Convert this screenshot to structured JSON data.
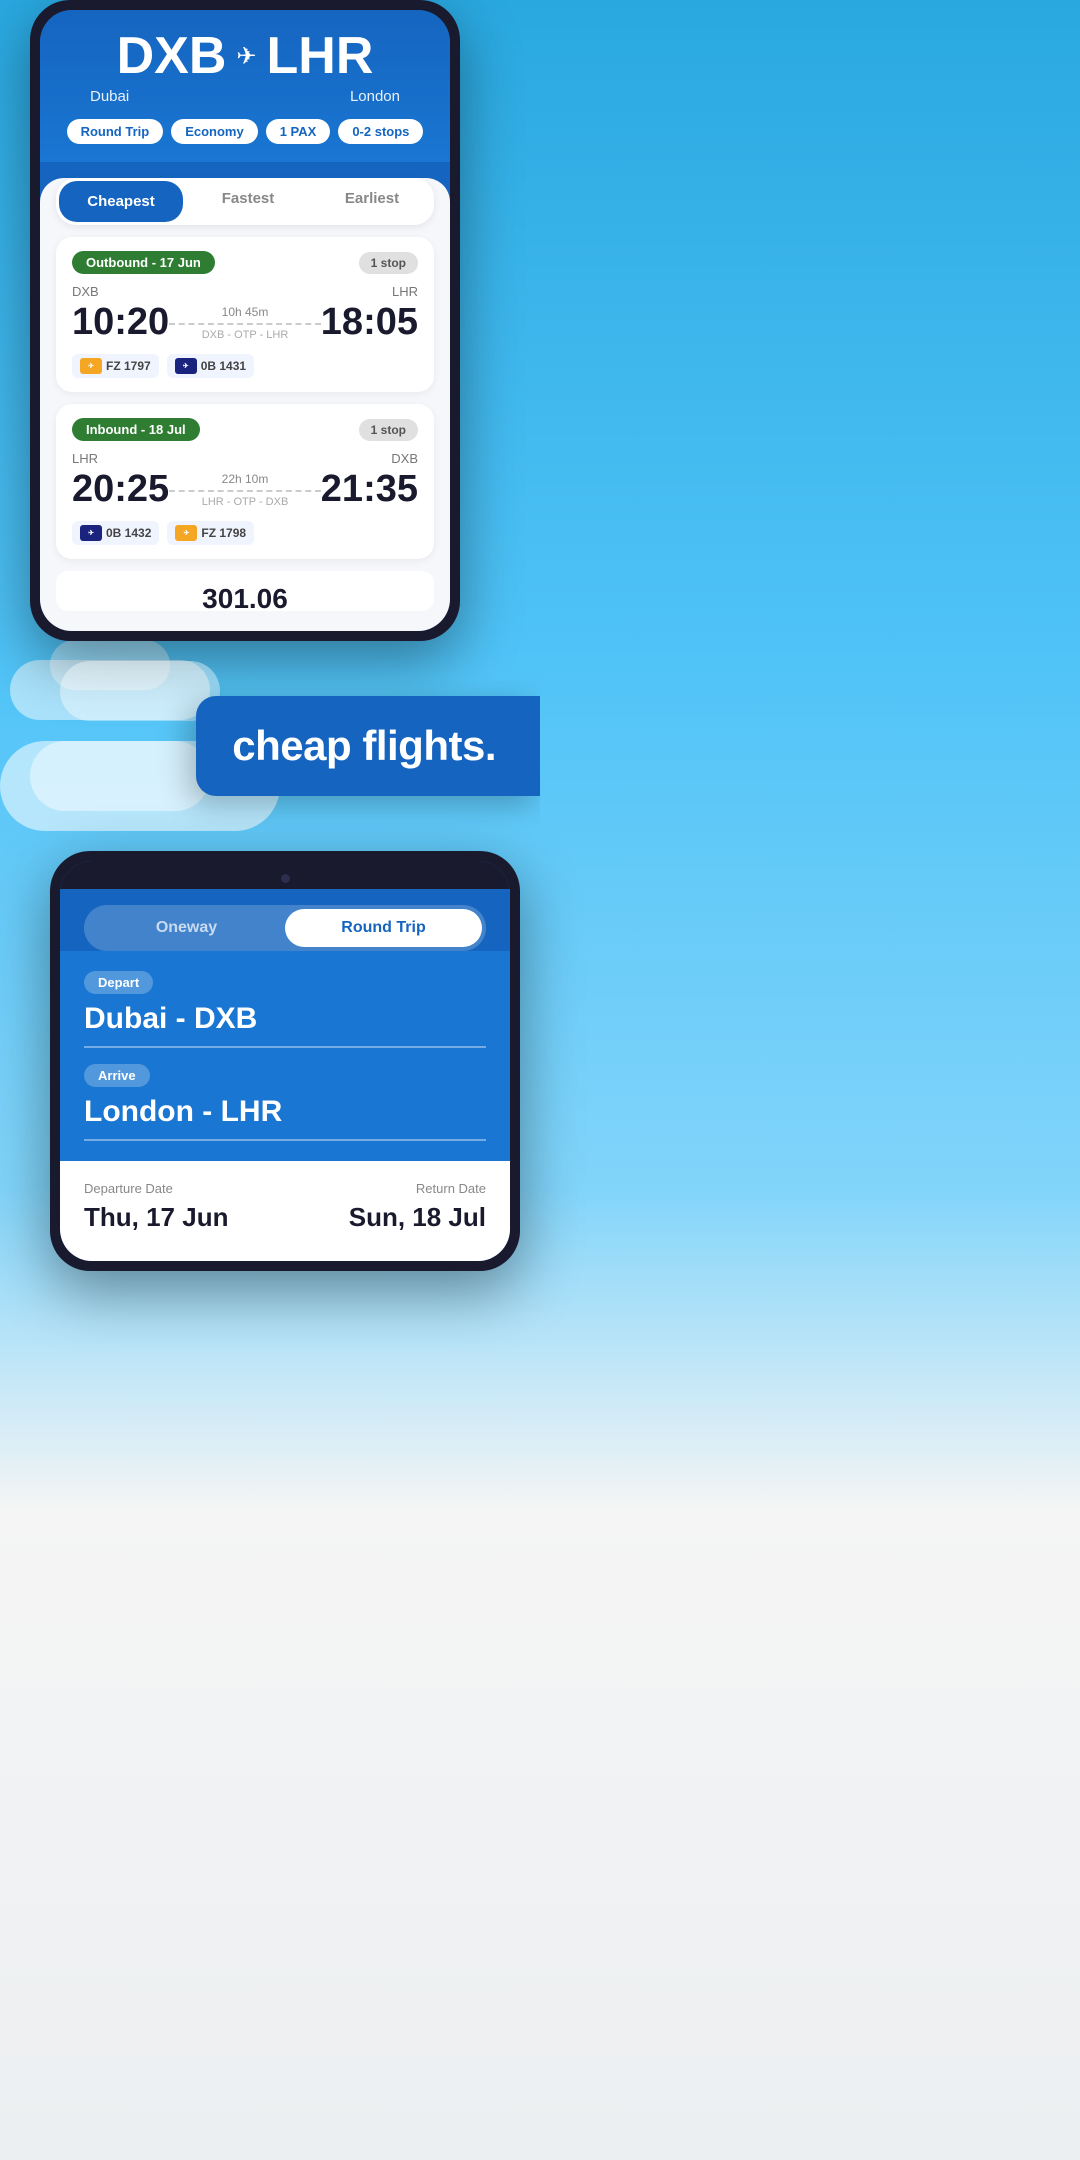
{
  "phone1": {
    "from_code": "DXB",
    "from_city": "Dubai",
    "to_code": "LHR",
    "to_city": "London",
    "tags": {
      "trip_type": "Round Trip",
      "cabin": "Economy",
      "pax": "1 PAX",
      "stops": "0-2 stops"
    },
    "tabs": {
      "cheapest": "Cheapest",
      "fastest": "Fastest",
      "earliest": "Earliest",
      "active": "cheapest"
    },
    "outbound": {
      "label": "Outbound - 17 Jun",
      "stops_badge": "1 stop",
      "from": "DXB",
      "to": "LHR",
      "dep_time": "10:20",
      "arr_time": "18:05",
      "duration": "10h 45m",
      "route": "DXB - OTP - LHR",
      "airlines": [
        {
          "code": "dubai",
          "flight": "FZ 1797"
        },
        {
          "code": "blue",
          "flight": "0B 1431"
        }
      ]
    },
    "inbound": {
      "label": "Inbound - 18 Jul",
      "stops_badge": "1 stop",
      "from": "LHR",
      "to": "DXB",
      "dep_time": "20:25",
      "arr_time": "21:35",
      "duration": "22h 10m",
      "route": "LHR - OTP - DXB",
      "airlines": [
        {
          "code": "blue",
          "flight": "0B 1432"
        },
        {
          "code": "dubai",
          "flight": "FZ 1798"
        }
      ]
    },
    "price_partial": "301.06"
  },
  "middle": {
    "tagline": "cheap flights."
  },
  "phone2": {
    "toggle": {
      "oneway": "Oneway",
      "round_trip": "Round Trip",
      "active": "round_trip"
    },
    "depart_label": "Depart",
    "depart_value": "Dubai - DXB",
    "arrive_label": "Arrive",
    "arrive_value": "London - LHR",
    "departure_date_label": "Departure Date",
    "departure_date": "Thu, 17 Jun",
    "return_date_label": "Return Date",
    "return_date": "Sun, 18 Jul"
  }
}
